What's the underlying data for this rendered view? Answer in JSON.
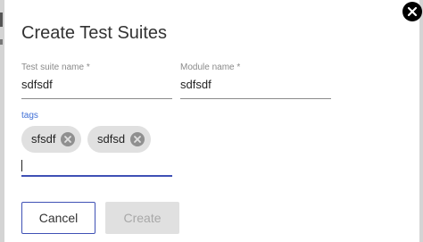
{
  "dialog": {
    "title": "Create Test Suites",
    "close_icon": "close-icon"
  },
  "form": {
    "suite_name": {
      "label": "Test suite name *",
      "value": "sdfsdf"
    },
    "module_name": {
      "label": "Module name *",
      "value": "sdfsdf"
    },
    "tags": {
      "label": "tags",
      "chips": [
        {
          "label": "sfsdf",
          "icon": "cancel-icon"
        },
        {
          "label": "sdfsd",
          "icon": "cancel-icon"
        }
      ],
      "input_value": ""
    }
  },
  "actions": {
    "cancel_label": "Cancel",
    "create_label": "Create",
    "create_disabled": true
  },
  "colors": {
    "accent": "#3f51b5",
    "tags_label": "#3f6fd6",
    "chip_bg": "#e0e0e0",
    "disabled_bg": "#e0e0e0"
  }
}
